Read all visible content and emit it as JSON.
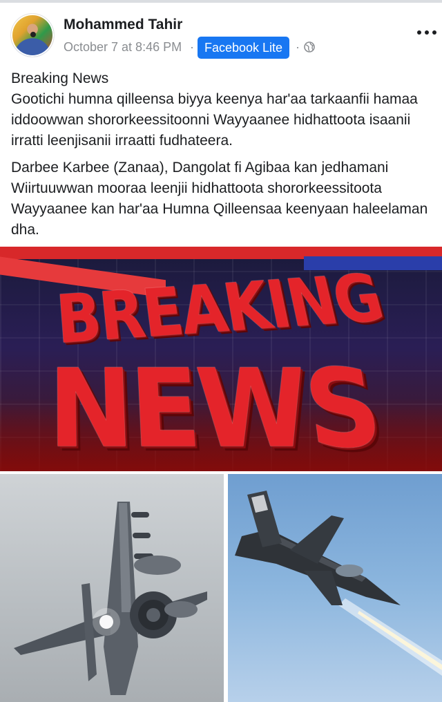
{
  "post": {
    "author": "Mohammed Tahir",
    "timestamp": "October 7 at 8:46 PM",
    "badge": "Facebook Lite",
    "audience_icon": "globe-icon",
    "menu_icon": "more-options-icon",
    "paragraphs": [
      "Breaking News\nGootichi humna qilleensa biyya keenya har'aa tarkaanfii hamaa iddoowwan shororkeessitoonni Wayyaanee hidhattoota isaanii irratti leenjisanii irraatti fudhateera.",
      "Darbee Karbee (Zanaa), Dangolat fi Agibaa kan jedhamani Wiirtuuwwan mooraa leenjii hidhattoota shororkeessitoota Wayyaanee kan har'aa Humna Qilleensaa keenyaan haleelaman dha."
    ]
  },
  "media": {
    "breaking_image": {
      "line1": "BREAKING",
      "line2": "NEWS"
    },
    "photos": [
      {
        "icon": "fighter-jet-photo"
      },
      {
        "icon": "fighter-jet-photo"
      }
    ]
  },
  "colors": {
    "badge_bg": "#1877f2",
    "text": "#1c1e21",
    "meta": "#8a8d91",
    "breaking_red": "#e4242a"
  }
}
